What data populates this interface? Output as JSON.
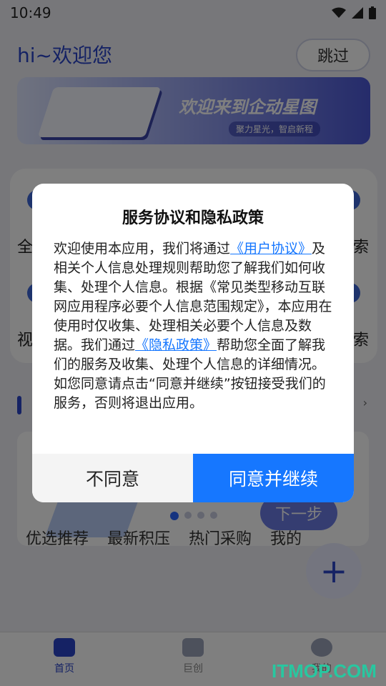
{
  "status_bar": {
    "time": "10:49",
    "icons": [
      "wifi-icon",
      "signal-icon",
      "battery-icon"
    ]
  },
  "header": {
    "greeting": "hi~欢迎您",
    "skip_label": "跳过"
  },
  "banner": {
    "title": "欢迎来到企动星图",
    "subtitle": "聚力星光，智启新程"
  },
  "background_grid": {
    "labels": [
      "全",
      "索",
      "视",
      "索"
    ]
  },
  "guide_popup": {
    "next_label": "下一步"
  },
  "tabs": [
    "优选推荐",
    "最新积压",
    "热门采购",
    "我的"
  ],
  "bottom_nav": [
    {
      "label": "首页",
      "icon": "home-icon",
      "active": true
    },
    {
      "label": "巨创",
      "icon": "camera-icon",
      "active": false
    },
    {
      "label": "我的",
      "icon": "user-icon",
      "active": false
    }
  ],
  "dialog": {
    "title": "服务协议和隐私政策",
    "p1_a": "欢迎使用本应用，我们将通过",
    "link_user": "《用户协议》",
    "p1_b": "及相关个人信息处理规则帮助您了解我们如何收集、处理个人信息。根据《常见类型移动互联网应用程序必要个人信息范围规定》，本应用在使用时仅收集、处理相关必要个人信息及数据。我们通过",
    "link_privacy": "《隐私政策》",
    "p1_c": "帮助您全面了解我们的服务及收集、处理个人信息的详细情况。",
    "p2": "如您同意请点击“同意并继续”按钮接受我们的服务，否则将退出应用。",
    "disagree_label": "不同意",
    "agree_label": "同意并继续"
  },
  "watermark": "ITMOP.COM",
  "colors": {
    "primary": "#1677ff",
    "brand": "#2a44c8",
    "watermark": "#28c7a0"
  }
}
